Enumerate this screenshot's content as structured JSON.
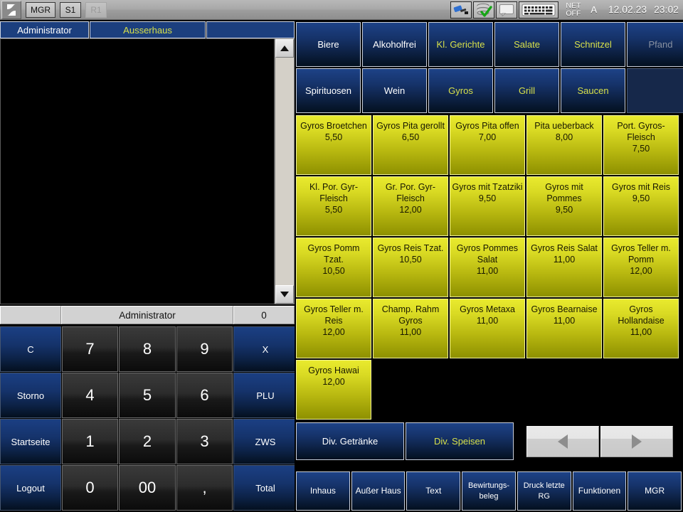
{
  "topbar": {
    "logo_icon": "hourglass-logo-icon",
    "buttons": [
      {
        "label": "MGR",
        "disabled": false
      },
      {
        "label": "S1",
        "disabled": false
      },
      {
        "label": "R1",
        "disabled": true
      }
    ],
    "status_icons": [
      {
        "name": "usb-connector-icon"
      },
      {
        "name": "database-ok-icon"
      },
      {
        "name": "screen-blank-icon"
      },
      {
        "name": "keyboard-icon"
      }
    ],
    "net_line1": "NET",
    "net_line2": "OFF",
    "language": "A",
    "date": "12.02.23",
    "time": "23:02"
  },
  "tabs": [
    {
      "label": "Administrator",
      "accent": false
    },
    {
      "label": "Ausserhaus",
      "accent": true
    },
    {
      "label": "",
      "accent": false
    }
  ],
  "infobar": {
    "left": "",
    "center": "Administrator",
    "right": "0"
  },
  "keypad": [
    {
      "label": "C",
      "type": "fn"
    },
    {
      "label": "7",
      "type": "num"
    },
    {
      "label": "8",
      "type": "num"
    },
    {
      "label": "9",
      "type": "num"
    },
    {
      "label": "X",
      "type": "fn"
    },
    {
      "label": "Storno",
      "type": "fn"
    },
    {
      "label": "4",
      "type": "num"
    },
    {
      "label": "5",
      "type": "num"
    },
    {
      "label": "6",
      "type": "num"
    },
    {
      "label": "PLU",
      "type": "fn"
    },
    {
      "label": "Startseite",
      "type": "fn"
    },
    {
      "label": "1",
      "type": "num"
    },
    {
      "label": "2",
      "type": "num"
    },
    {
      "label": "3",
      "type": "num"
    },
    {
      "label": "ZWS",
      "type": "fn"
    },
    {
      "label": "Logout",
      "type": "fn"
    },
    {
      "label": "0",
      "type": "num"
    },
    {
      "label": "00",
      "type": "num"
    },
    {
      "label": ",",
      "type": "num"
    },
    {
      "label": "Total",
      "type": "fn"
    }
  ],
  "categories": [
    {
      "label": "Biere",
      "state": "normal"
    },
    {
      "label": "Alkoholfrei",
      "state": "normal"
    },
    {
      "label": "Kl. Gerichte",
      "state": "accent"
    },
    {
      "label": "Salate",
      "state": "accent"
    },
    {
      "label": "Schnitzel",
      "state": "accent"
    },
    {
      "label": "Pfand",
      "state": "disabled"
    },
    {
      "label": "Spirituosen",
      "state": "normal"
    },
    {
      "label": "Wein",
      "state": "normal"
    },
    {
      "label": "Gyros",
      "state": "accent"
    },
    {
      "label": "Grill",
      "state": "accent"
    },
    {
      "label": "Saucen",
      "state": "accent"
    },
    {
      "label": "",
      "state": "empty"
    }
  ],
  "products": [
    {
      "name": "Gyros Broetchen",
      "price": "5,50"
    },
    {
      "name": "Gyros Pita gerollt",
      "price": "6,50"
    },
    {
      "name": "Gyros Pita offen",
      "price": "7,00"
    },
    {
      "name": "Pita ueberback",
      "price": "8,00"
    },
    {
      "name": "Port. Gyros-Fleisch",
      "price": "7,50"
    },
    {
      "name": "Kl. Por. Gyr-Fleisch",
      "price": "5,50"
    },
    {
      "name": "Gr. Por. Gyr-Fleisch",
      "price": "12,00"
    },
    {
      "name": "Gyros mit Tzatziki",
      "price": "9,50"
    },
    {
      "name": "Gyros mit Pommes",
      "price": "9,50"
    },
    {
      "name": "Gyros mit Reis",
      "price": "9,50"
    },
    {
      "name": "Gyros Pomm Tzat.",
      "price": "10,50"
    },
    {
      "name": "Gyros Reis Tzat.",
      "price": "10,50"
    },
    {
      "name": "Gyros Pommes Salat",
      "price": "11,00"
    },
    {
      "name": "Gyros Reis Salat",
      "price": "11,00"
    },
    {
      "name": "Gyros Teller m. Pomm",
      "price": "12,00"
    },
    {
      "name": "Gyros Teller m. Reis",
      "price": "12,00"
    },
    {
      "name": "Champ. Rahm Gyros",
      "price": "11,00"
    },
    {
      "name": "Gyros Metaxa",
      "price": "11,00"
    },
    {
      "name": "Gyros Bearnaise",
      "price": "11,00"
    },
    {
      "name": "Gyros Hollandaise",
      "price": "11,00"
    },
    {
      "name": "Gyros Hawai",
      "price": "12,00"
    }
  ],
  "div_buttons": [
    {
      "label": "Div. Getränke",
      "accent": false
    },
    {
      "label": "Div. Speisen",
      "accent": true
    }
  ],
  "nav_buttons": [
    {
      "name": "page-prev-icon"
    },
    {
      "name": "page-next-icon"
    }
  ],
  "footer": [
    {
      "label": "Inhaus"
    },
    {
      "label": "Außer Haus"
    },
    {
      "label": "Text"
    },
    {
      "label": "Bewirtungs-beleg"
    },
    {
      "label": "Druck letzte RG"
    },
    {
      "label": "Funktionen"
    },
    {
      "label": "MGR"
    }
  ],
  "colors": {
    "blue_button": "#1d4287",
    "yellow_button": "#d9da23",
    "accent_text": "#d7e04a",
    "tab_blue": "#1c3f7e"
  }
}
